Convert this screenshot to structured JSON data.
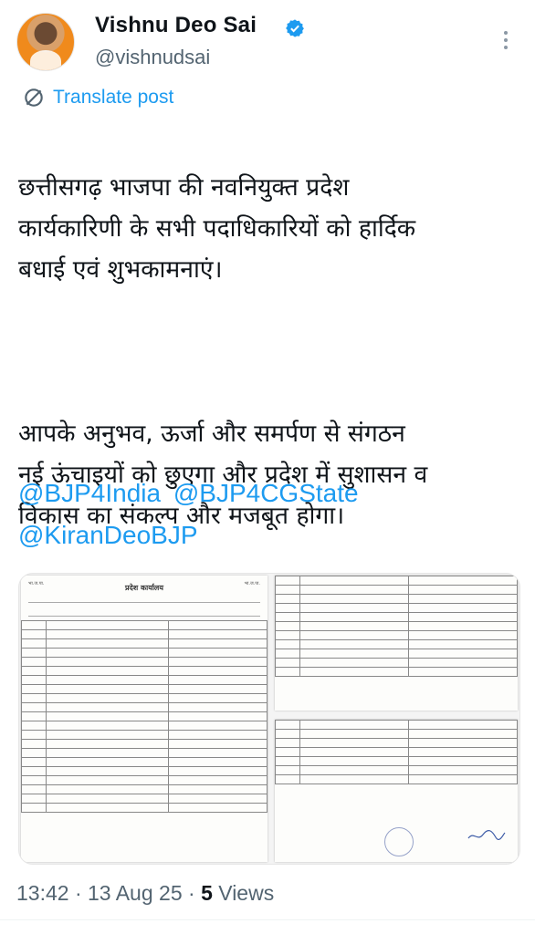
{
  "author": {
    "name": "Vishnu Deo Sai",
    "handle": "@vishnudsai",
    "verified": true
  },
  "translate_label": "Translate post",
  "post": {
    "paragraph1": "छत्तीसगढ़ भाजपा की नवनियुक्त प्रदेश\nकार्यकारिणी के सभी पदाधिकारियों को हार्दिक\nबधाई एवं शुभकामनाएं।",
    "paragraph2": "आपके अनुभव, ऊर्जा और समर्पण से संगठन\nनई ऊंचाइयों को छुएगा और प्रदेश में सुशासन व\nविकास का संकल्प और मजबूत होगा।",
    "mentions": [
      "@BJP4India",
      "@BJP4CGState",
      "@KiranDeoBJP"
    ]
  },
  "media": {
    "doc1_title": "प्रदेश कार्यालय",
    "doc1_logo_text": "भा.ज.पा."
  },
  "meta": {
    "time": "13:42",
    "date": "13 Aug 25",
    "views_count": "5",
    "views_label": "Views"
  },
  "colors": {
    "accent": "#1d9bf0",
    "text": "#0f1419",
    "secondary": "#536471"
  }
}
